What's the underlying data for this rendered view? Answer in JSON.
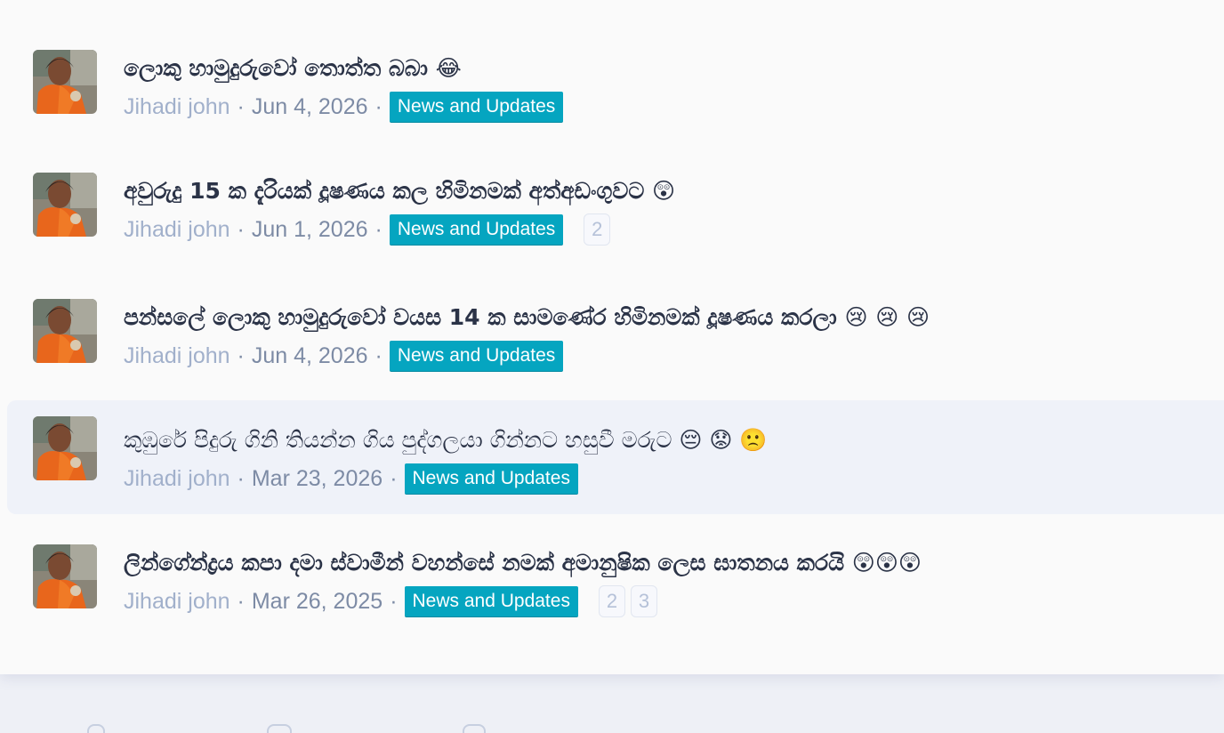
{
  "threads": [
    {
      "title": "ලොකු හාමුදුරුවෝ තොත්ත බබා 😂",
      "author": "Jihadi john",
      "date": "Jun 4, 2026",
      "forum": "News and Updates",
      "pages": []
    },
    {
      "title": "අවුරුදු 15 ක දැරියක් දූෂණය කල හිමිනමක් අත්අඩංගුවට 😲",
      "author": "Jihadi john",
      "date": "Jun 1, 2026",
      "forum": "News and Updates",
      "pages": [
        "2"
      ]
    },
    {
      "title": "පන්සලේ ලොකු හාමුදුරුවෝ වයස 14 ක සාමණේර හිමිනමක් දූෂණය කරලා 😢 😢 😢",
      "author": "Jihadi john",
      "date": "Jun 4, 2026",
      "forum": "News and Updates",
      "pages": []
    },
    {
      "title": "කුඹුරේ පිදුරු ගිනි තියන්න ගිය පුද්ගලයා ගින්නට හසුවී මරුට 😔 😟 🙁",
      "author": "Jihadi john",
      "date": "Mar 23, 2026",
      "forum": "News and Updates",
      "pages": []
    },
    {
      "title": "ලින්ගේන්ද්‍රය කපා දමා ස්වාමීන් වහන්සේ නමක් අමානුෂික ලෙස ඝාතනය කරයි 😲😲😲",
      "author": "Jihadi john",
      "date": "Mar 26, 2025",
      "forum": "News and Updates",
      "pages": [
        "2",
        "3"
      ]
    }
  ],
  "separator": "·",
  "colors": {
    "tag_background": "#05a5c0",
    "title_text": "#2b3347",
    "author_text": "#a1b0cb",
    "highlight_row": "#eff2f9"
  },
  "icons": {
    "avatar": "user-avatar-image"
  }
}
